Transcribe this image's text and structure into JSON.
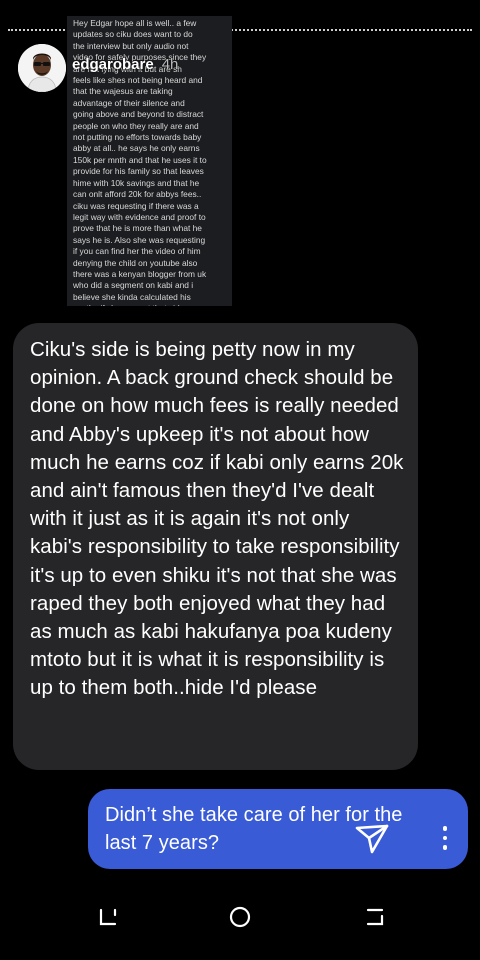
{
  "story": {
    "username": "edgarobare",
    "time": "4h",
    "text": "Hey Edgar hope all is well.. a few\nupdates so ciku does want to do\nthe interview but only audio not\nvideo for safely purposes since they\nare not lying with it but are sh\nfeels like shes not being heard and\nthat the wajesus are taking\nadvantage of their silence and\ngoing above and beyond to distract\npeople on who they really are and\nnot putting no efforts towards baby\nabby at all.. he says he only earns\n150k per mnth and that he uses it to\nprovide for his family so that leaves\nhime with 10k savings and that he\ncan onlt afford 20k for abbys fees..\nciku was requesting if there was a\nlegit way with evidence and proof to\nprove that he is more than what he\nsays he is. Also she was requesting\nif you can find her the video of him\ndenying the child on youtube also\nthere was a kenyan blogger from uk\nwho did a segment on kabi and i\nbelieve she kinda calculated his\nworth.. if she can get that video"
  },
  "messages": {
    "received": "Ciku's side is being petty now in my opinion. A back ground check should be done on how much fees is really needed and Abby's upkeep it's not about how much he earns coz if kabi only earns 20k and ain't famous then they'd I've dealt with it just as it is again it's not only kabi's responsibility to take responsibility it's up to even shiku it's not that she was raped they both enjoyed what they had as much as kabi hakufanya poa kudeny mtoto but it is what it is responsibility is up to them both..hide I'd please",
    "sent": "Didn’t she take care of her for the last 7 years?"
  },
  "icons": {
    "send": "send-icon",
    "more": "more-options-icon",
    "nav_recents": "recents-icon",
    "nav_home": "home-icon",
    "nav_back": "back-icon"
  },
  "colors": {
    "background": "#000000",
    "received_bubble": "#262628",
    "sent_bubble": "#3a5bd6"
  }
}
